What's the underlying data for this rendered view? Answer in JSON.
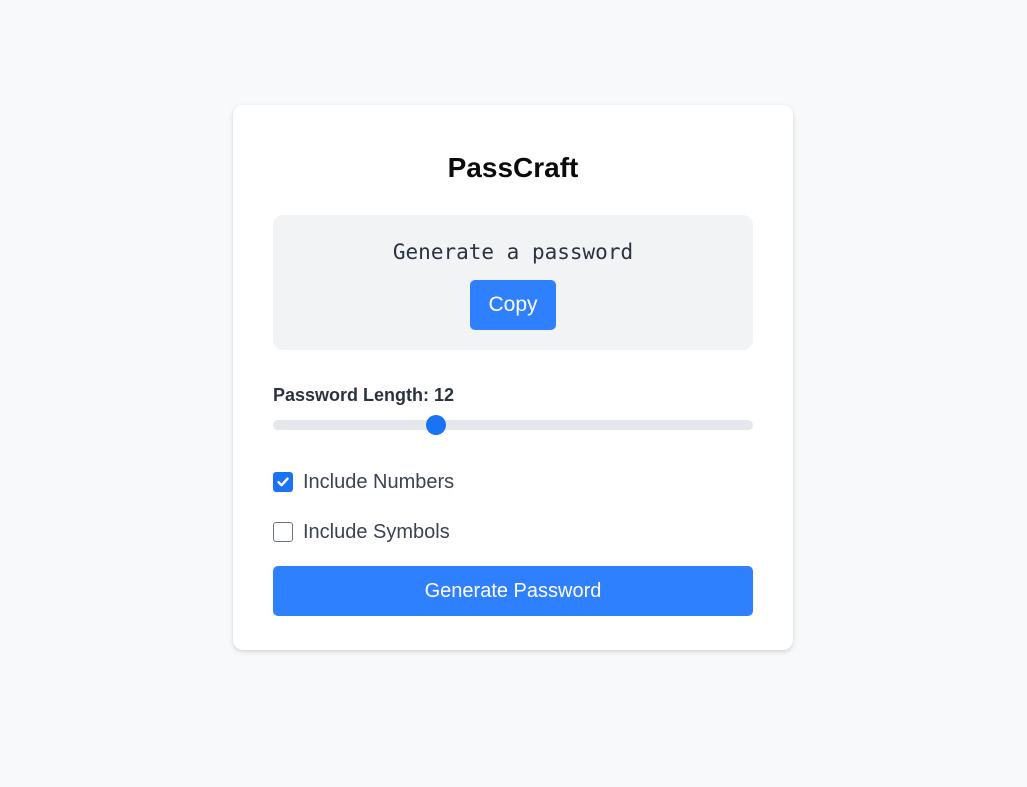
{
  "app": {
    "title": "PassCraft"
  },
  "output": {
    "password_text": "Generate a password",
    "copy_label": "Copy"
  },
  "length": {
    "label_prefix": "Password Length: ",
    "value": "12",
    "fraction": 0.34
  },
  "options": {
    "numbers": {
      "label": "Include Numbers",
      "checked": true
    },
    "symbols": {
      "label": "Include Symbols",
      "checked": false
    }
  },
  "generate": {
    "label": "Generate Password"
  },
  "colors": {
    "accent": "#2f80ff",
    "check": "#1a73f5",
    "background": "#f8f9fb"
  },
  "icons": {
    "check": "check-icon"
  }
}
